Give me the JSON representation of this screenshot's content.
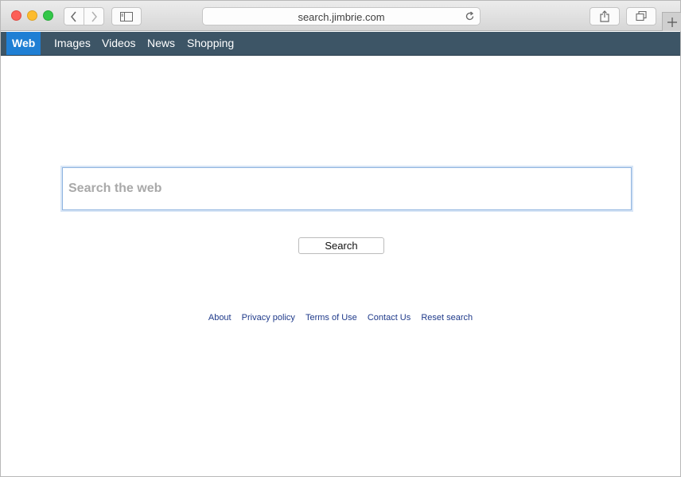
{
  "browser": {
    "url": "search.jimbrie.com"
  },
  "nav": {
    "items": [
      {
        "label": "Web",
        "active": true
      },
      {
        "label": "Images",
        "active": false
      },
      {
        "label": "Videos",
        "active": false
      },
      {
        "label": "News",
        "active": false
      },
      {
        "label": "Shopping",
        "active": false
      }
    ]
  },
  "search": {
    "value": "",
    "placeholder": "Search the web",
    "button_label": "Search"
  },
  "footer": {
    "links": [
      "About",
      "Privacy policy",
      "Terms of Use",
      "Contact Us",
      "Reset search"
    ]
  },
  "colors": {
    "nav_background": "#3d5566",
    "nav_active": "#1f7fd4",
    "link": "#1f3a8a"
  }
}
